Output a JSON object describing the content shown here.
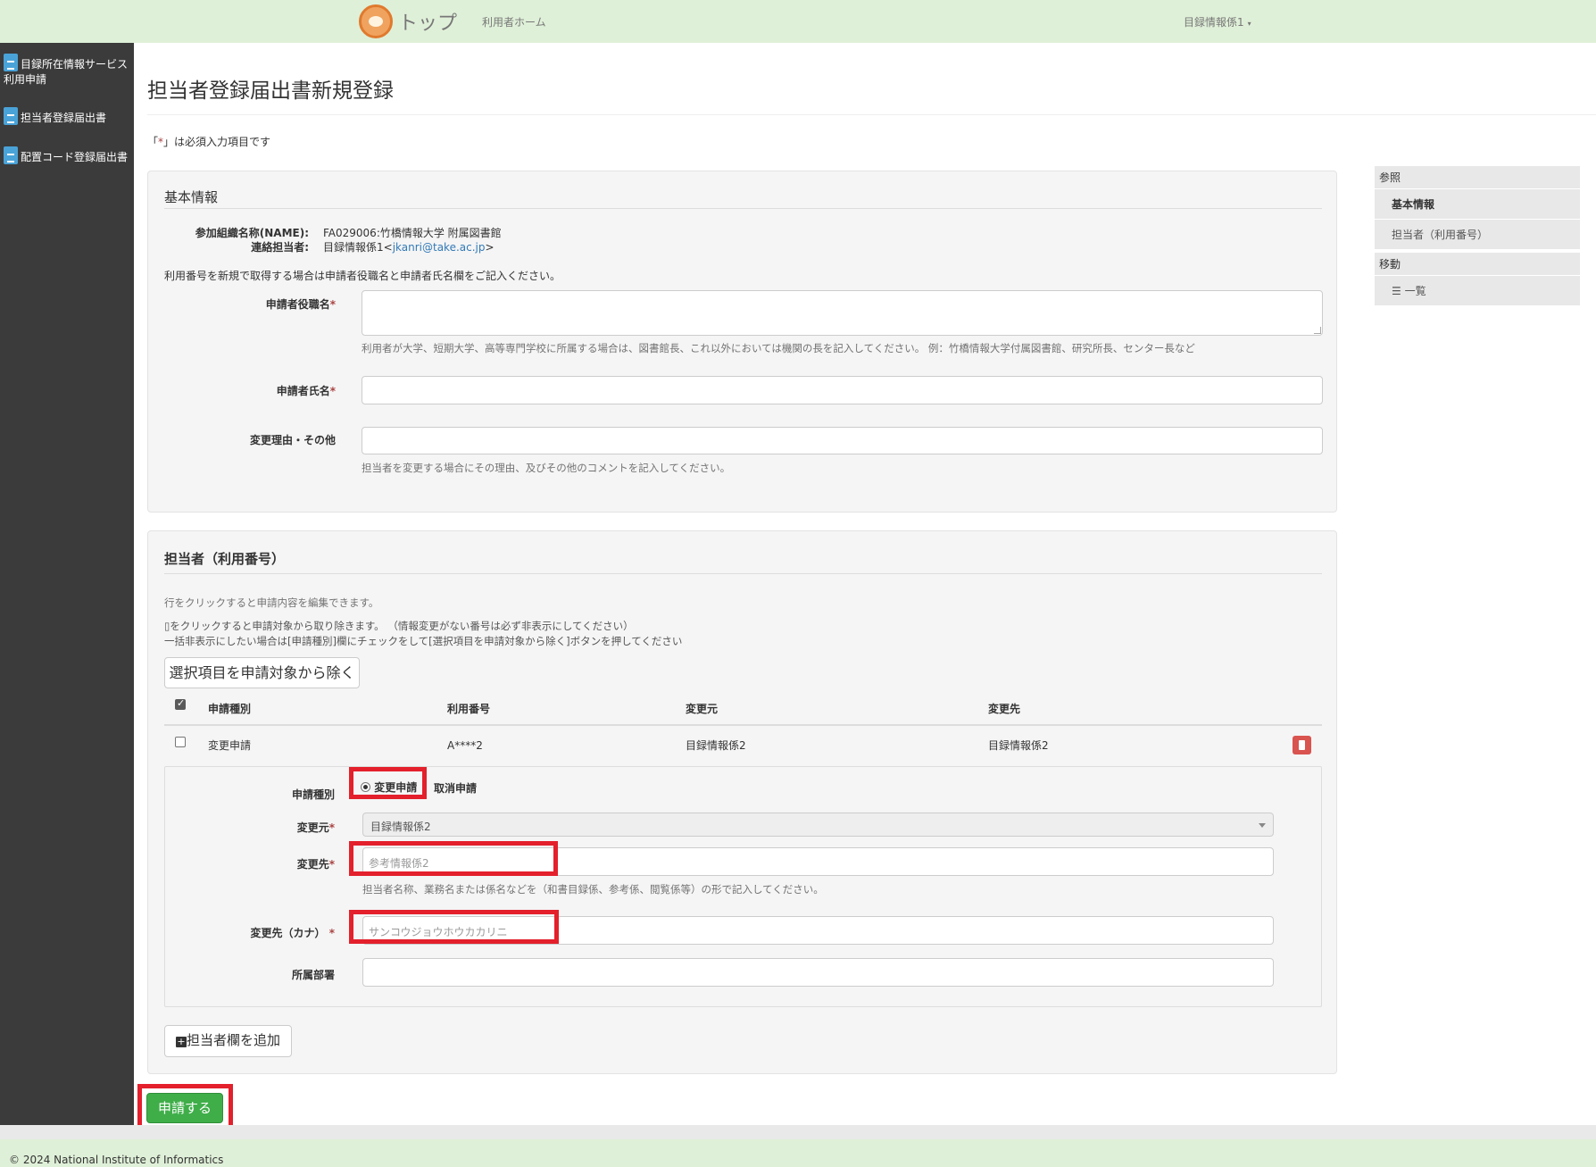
{
  "navbar": {
    "brand": "トップ",
    "home_link": "利用者ホーム",
    "user_menu": "目録情報係1",
    "caret": "▾"
  },
  "sidebar": {
    "items": [
      {
        "label": "目録所在情報サービス利用申請",
        "icon": "document-icon"
      },
      {
        "label": "担当者登録届出書",
        "icon": "document-icon"
      },
      {
        "label": "配置コード登録届出書",
        "icon": "document-icon"
      }
    ]
  },
  "page": {
    "title": "担当者登録届出書新規登録",
    "required_note_open": "「",
    "required_note_star": "*",
    "required_note_close": "」は必須入力項目です"
  },
  "basic_info": {
    "legend": "基本情報",
    "org_label": "参加組織名称(NAME):",
    "org_value": "FA029006:竹橋情報大学 附属図書館",
    "contact_label": "連絡担当者:",
    "contact_name": "目録情報係1<",
    "contact_email": "jkanri@take.ac.jp",
    "contact_close": ">",
    "instruction": "利用番号を新規で取得する場合は申請者役職名と申請者氏名欄をご記入ください。",
    "applicant_title_label": "申請者役職名",
    "applicant_title_value": "",
    "applicant_title_help": "利用者が大学、短期大学、高等専門学校に所属する場合は、図書館長、これ以外においては機関の長を記入してください。 例：竹橋情報大学付属図書館、研究所長、センター長など",
    "applicant_name_label": "申請者氏名",
    "applicant_name_value": "",
    "reason_label": "変更理由・その他",
    "reason_value": "",
    "reason_help": "担当者を変更する場合にその理由、及びその他のコメントを記入してください。",
    "required_mark": "*"
  },
  "staff": {
    "legend": "担当者（利用番号）",
    "note1": "行をクリックすると申請内容を編集できます。",
    "note2": "▯をクリックすると申請対象から取り除きます。 （情報変更がない番号は必ず非表示にしてください）",
    "note3": "一括非表示にしたい場合は[申請種別]欄にチェックをして[選択項目を申請対象から除く]ボタンを押してください",
    "remove_selected_button": "選択項目を申請対象から除く",
    "columns": [
      "申請種別",
      "利用番号",
      "変更元",
      "変更先"
    ],
    "rows": [
      {
        "type": "変更申請",
        "number": "A****2",
        "from": "目録情報係2",
        "to": "目録情報係2"
      }
    ],
    "edit": {
      "type_label": "申請種別",
      "radio_change": "変更申請",
      "radio_cancel": "取消申請",
      "from_label": "変更元",
      "from_selected": "目録情報係2",
      "to_label": "変更先",
      "to_placeholder": "参考情報係2",
      "to_help": "担当者名称、業務名または係名などを（和書目録係、参考係、閲覧係等）の形で記入してください。",
      "kana_label": "変更先（カナ）",
      "kana_placeholder": "サンコウジョウホウカカリニ",
      "dept_label": "所属部署",
      "dept_value": "",
      "required_mark": "*"
    },
    "add_button": "担当者欄を追加"
  },
  "submit_button": "申請する",
  "right_nav": {
    "ref_heading": "参照",
    "ref_items": [
      "基本情報",
      "担当者（利用番号）"
    ],
    "move_heading": "移動",
    "move_items": [
      "一覧"
    ]
  },
  "footer": {
    "copyright": "© 2024 National Institute of Informatics"
  },
  "colors": {
    "navbar_bg": "#dff0d8",
    "sidebar_bg": "#3b3b3b",
    "highlight": "#e3202c",
    "submit": "#3fae49",
    "link": "#337ab7",
    "danger": "#d9534f"
  }
}
